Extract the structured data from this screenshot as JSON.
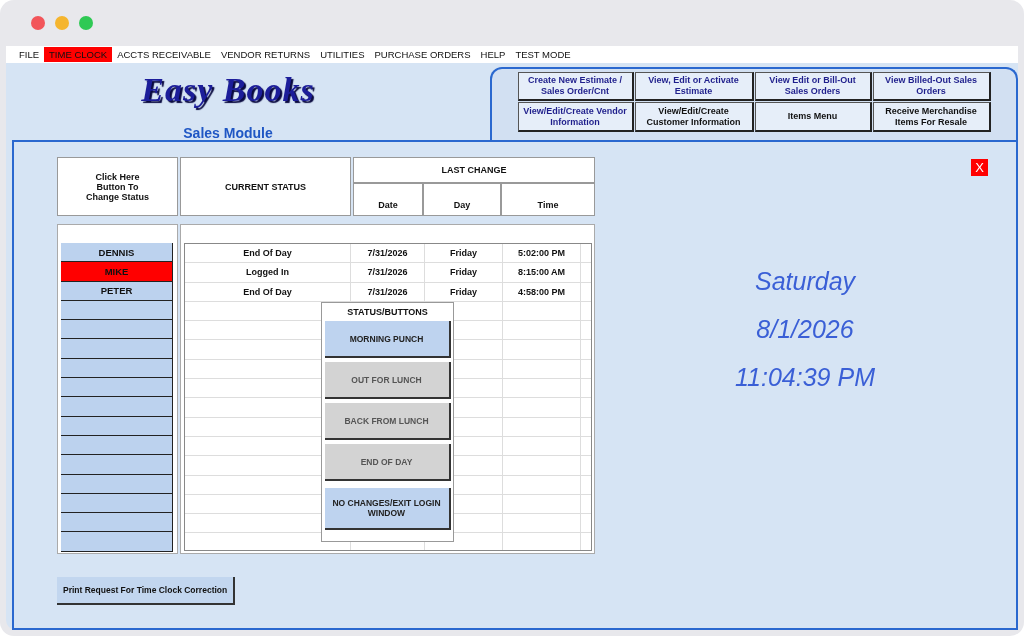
{
  "menu": [
    {
      "label": "FILE",
      "selected": false
    },
    {
      "label": "TIME CLOCK",
      "selected": true
    },
    {
      "label": "ACCTS RECEIVABLE",
      "selected": false
    },
    {
      "label": "VENDOR RETURNS",
      "selected": false
    },
    {
      "label": "UTILITIES",
      "selected": false
    },
    {
      "label": "PURCHASE ORDERS",
      "selected": false
    },
    {
      "label": "HELP",
      "selected": false
    },
    {
      "label": "TEST MODE",
      "selected": false
    }
  ],
  "logo": "Easy Books",
  "module_title": "Sales Module",
  "nav_buttons": [
    {
      "label": "Create New Estimate / Sales Order/Cnt",
      "kind": "accent"
    },
    {
      "label": "View, Edit or Activate Estimate",
      "kind": "accent"
    },
    {
      "label": "View Edit or Bill-Out Sales Orders",
      "kind": "accent"
    },
    {
      "label": "View Billed-Out Sales Orders",
      "kind": "accent"
    },
    {
      "label": "View/Edit/Create Vendor Information",
      "kind": "accent"
    },
    {
      "label": "View/Edit/Create Customer Information",
      "kind": "plain"
    },
    {
      "label": "Items Menu",
      "kind": "plain"
    },
    {
      "label": "Receive Merchandise Items For Resale",
      "kind": "plain"
    }
  ],
  "header": {
    "change_status": "Click Here Button To Change Status",
    "current_status": "CURRENT STATUS",
    "last_change": "LAST CHANGE",
    "date": "Date",
    "day": "Day",
    "time": "Time"
  },
  "employees": [
    {
      "name": "DENNIS",
      "selected": false
    },
    {
      "name": "MIKE",
      "selected": true
    },
    {
      "name": "PETER",
      "selected": false
    }
  ],
  "rows": [
    {
      "status": "End Of Day",
      "date": "7/31/2026",
      "day": "Friday",
      "time": "5:02:00 PM"
    },
    {
      "status": "Logged In",
      "date": "7/31/2026",
      "day": "Friday",
      "time": "8:15:00 AM"
    },
    {
      "status": "End Of Day",
      "date": "7/31/2026",
      "day": "Friday",
      "time": "4:58:00 PM"
    }
  ],
  "status_popup": {
    "title": "STATUS/BUTTONS",
    "buttons": [
      {
        "label": "MORNING PUNCH",
        "disabled": false
      },
      {
        "label": "OUT FOR LUNCH",
        "disabled": true
      },
      {
        "label": "BACK FROM LUNCH",
        "disabled": true
      },
      {
        "label": "END OF DAY",
        "disabled": true
      },
      {
        "label": "NO CHANGES/EXIT LOGIN WINDOW",
        "disabled": false
      }
    ]
  },
  "close_label": "X",
  "clock": {
    "day": "Saturday",
    "date": "8/1/2026",
    "time": "11:04:39 PM"
  },
  "print_button": "Print Request For Time Clock Correction"
}
